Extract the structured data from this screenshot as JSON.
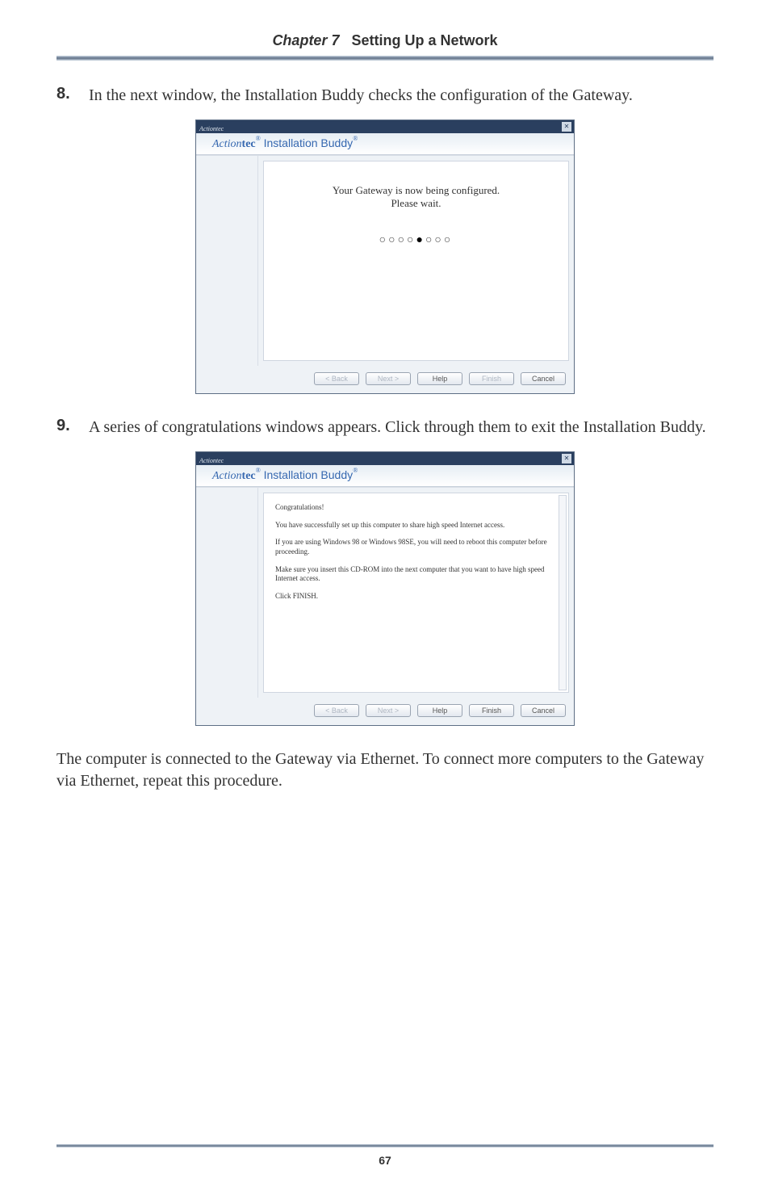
{
  "header": {
    "chapter": "Chapter 7",
    "title": "Setting Up a Network"
  },
  "steps": [
    {
      "num": "8.",
      "text": "In the next window, the Installation Buddy checks the configuration of the Gateway."
    },
    {
      "num": "9.",
      "text": "A series of congratulations windows appears. Click through them to exit the Installation Buddy."
    }
  ],
  "closing": "The computer is connected to the Gateway via Ethernet. To connect more computers to the Gateway via Ethernet, repeat this procedure.",
  "dialog1": {
    "titlebar_label": "Actiontec",
    "close": "✕",
    "brand_action": "Action",
    "brand_tec": "tec",
    "brand_suffix": " Installation Buddy",
    "reg": "®",
    "msg1": "Your Gateway is now being configured.",
    "msg2": "Please wait.",
    "dots_empty": "○○○○",
    "dots_fill": "●",
    "dots_empty2": "○○○",
    "buttons": {
      "back": "< Back",
      "next": "Next >",
      "help": "Help",
      "finish": "Finish",
      "cancel": "Cancel"
    }
  },
  "dialog2": {
    "titlebar_label": "Actiontec",
    "close": "✕",
    "brand_action": "Action",
    "brand_tec": "tec",
    "brand_suffix": " Installation Buddy",
    "reg": "®",
    "p1": "Congratulations!",
    "p2": "You have successfully set up this computer to share high speed Internet access.",
    "p3": "If you are using Windows 98 or Windows 98SE, you will need to reboot this computer before proceeding.",
    "p4": "Make sure you insert this CD-ROM into the next computer that you want to have high speed Internet access.",
    "p5": "Click FINISH.",
    "buttons": {
      "back": "< Back",
      "next": "Next >",
      "help": "Help",
      "finish": "Finish",
      "cancel": "Cancel"
    }
  },
  "pagenum": "67"
}
